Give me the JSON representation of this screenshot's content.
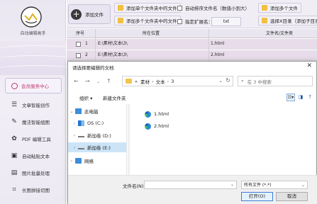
{
  "app": {
    "name": "自动编辑高手"
  },
  "sidebar": {
    "member_label": "会员服务中心",
    "items": [
      {
        "label": "文章智能创作",
        "icon": "document-icon"
      },
      {
        "label": "魔法智能组图",
        "icon": "magic-icon"
      },
      {
        "label": "PDF 编辑工具",
        "icon": "pdf-icon"
      },
      {
        "label": "自动粘贴文本",
        "icon": "paste-icon"
      },
      {
        "label": "图片批量处理",
        "icon": "image-icon"
      },
      {
        "label": "长图拼接切图",
        "icon": "crop-icon"
      }
    ]
  },
  "toolbar": {
    "add_file": "添加文件",
    "add_single_folder": "添加单个文件夹中的文件",
    "add_multi_folder": "添加多个文件夹中的文件",
    "auto_sort": "自动排序文件名（数值小到大）",
    "specify_ext": "指定扩展名：",
    "ext_value": "txt",
    "add_multi_files": "添加多个文件",
    "select_dir_partial": "选择X目录（添加子目录"
  },
  "grid": {
    "headers": [
      "序号",
      "所在位置",
      "文件名/文件夹"
    ],
    "rows": [
      {
        "index": "1",
        "location": "E:\\素材\\文本\\3\\",
        "name": "1.html"
      },
      {
        "index": "2",
        "location": "E:\\素材\\文本\\3\\",
        "name": "2.html"
      }
    ]
  },
  "dialog": {
    "title": "请选择要编辑的文档",
    "close": "✕",
    "breadcrumb": [
      "«",
      "素材",
      "文本",
      "3"
    ],
    "search_placeholder": "在 3 中搜索",
    "organize": "组织 ▾",
    "new_folder": "新建文件夹",
    "tree": [
      {
        "label": "此电脑",
        "arrow": "⌄",
        "icon": "computer-icon"
      },
      {
        "label": "OS (C:)",
        "arrow": "›",
        "icon": "drive-icon"
      },
      {
        "label": "新加卷 (D:)",
        "arrow": "›",
        "icon": "drive-icon"
      },
      {
        "label": "新加卷 (E:)",
        "arrow": "›",
        "icon": "drive-icon"
      },
      {
        "label": "网络",
        "arrow": "›",
        "icon": "network-icon"
      }
    ],
    "files": [
      "1.html",
      "2.html"
    ],
    "filename_label": "文件名(N):",
    "filename_value": "",
    "filetype_value": "所有文件 (*.*)",
    "open_button": "打开(O)",
    "cancel_button": "取消"
  }
}
